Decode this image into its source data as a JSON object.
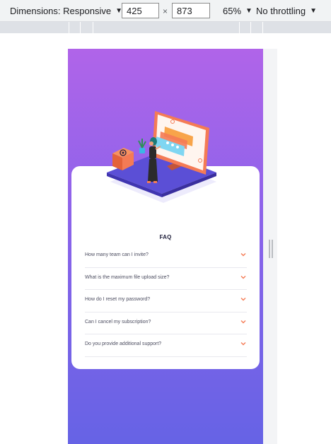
{
  "devtools": {
    "dimensions_label": "Dimensions: Responsive",
    "width_value": "425",
    "times_sign": "×",
    "height_value": "873",
    "zoom_label": "65%",
    "throttling_label": "No throttling"
  },
  "faq": {
    "title": "FAQ",
    "accent_color": "#f47b55",
    "items": [
      {
        "question": "How many team can I invite?"
      },
      {
        "question": "What is the maximum file upload size?"
      },
      {
        "question": "How do I reset my password?"
      },
      {
        "question": "Can I cancel my subscription?"
      },
      {
        "question": "Do you provide additional support?"
      }
    ]
  },
  "colors": {
    "gradient_top": "#b064e9",
    "gradient_bottom": "#6663e5",
    "title_text": "#1f1f3b",
    "question_text": "#4b4c5f"
  }
}
